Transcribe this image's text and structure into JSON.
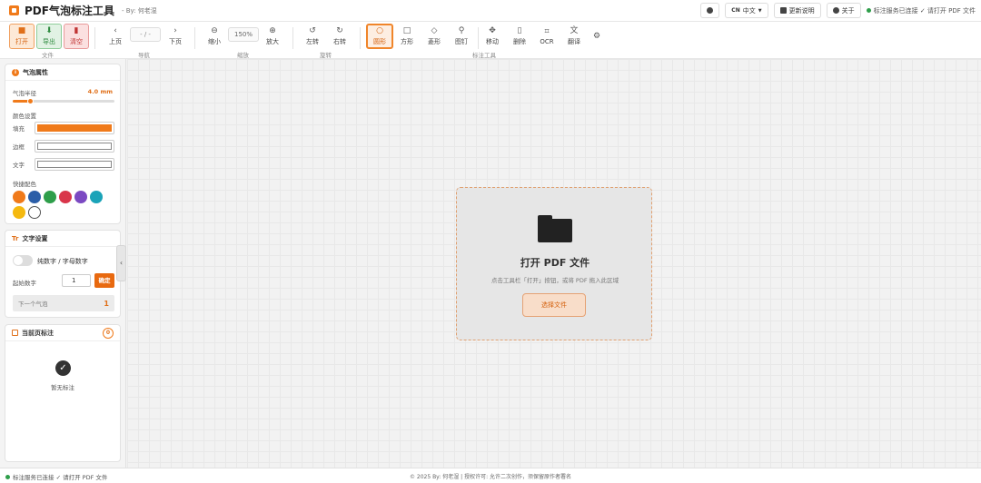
{
  "app": {
    "title": "PDF气泡标注工具",
    "byline": "- By: 何老湿"
  },
  "top_right": {
    "lang_prefix": "CN",
    "lang_label": "中文",
    "changelog_label": "更新说明",
    "about_label": "关于",
    "status_text": "标注服务已连接 ✓ 请打开 PDF 文件"
  },
  "toolbar": {
    "file": {
      "open": "打开",
      "export": "导出",
      "clear": "清空",
      "group": "文件"
    },
    "nav": {
      "prev": "上页",
      "page_display": "- / -",
      "next": "下页",
      "group": "导航"
    },
    "zoom": {
      "out": "缩小",
      "level": "150%",
      "in": "放大",
      "group": "缩放"
    },
    "rotate": {
      "left": "左转",
      "right": "右转",
      "group": "旋转"
    },
    "tools": {
      "circle": "圆形",
      "square": "方形",
      "diamond": "菱形",
      "pin": "图钉",
      "move": "移动",
      "delete": "删除",
      "ocr": "OCR",
      "translate": "翻译",
      "group": "标注工具"
    }
  },
  "bubble_props": {
    "title": "气泡属性",
    "radius_label": "气泡半径",
    "radius_value": "4.0 mm",
    "radius_fraction": 0.18,
    "color_settings": "颜色设置",
    "fill_label": "填充",
    "border_label": "边框",
    "text_label": "文字",
    "fill_color": "#f07a1a",
    "border_color": "#ffffff",
    "text_color": "#ffffff",
    "quick_colors_label": "快捷配色",
    "palette": [
      "#f07a1a",
      "#2b5ea8",
      "#2e9e4a",
      "#d9354a",
      "#7b49c2",
      "#1aa3b8",
      "#f5b90f",
      "#ffffff"
    ]
  },
  "text_settings": {
    "title": "文字设置",
    "toggle_label": "纯数字 / 字母数字",
    "start_label": "起始数字",
    "start_value": "1",
    "confirm_label": "确定",
    "next_label": "下一个气泡",
    "next_value": "1"
  },
  "current_page": {
    "title": "当前页标注",
    "count": "0",
    "empty_text": "暂无标注"
  },
  "dropzone": {
    "title": "打开 PDF 文件",
    "subtitle": "点击工具栏「打开」按钮，或将 PDF 拖入此区域",
    "button": "选择文件"
  },
  "footer": {
    "status_text": "标注服务已连接 ✓ 请打开 PDF 文件",
    "copyright": "© 2025 By: 何老湿 | 授权许可: 允许二次创作，须保留原作者署名"
  }
}
